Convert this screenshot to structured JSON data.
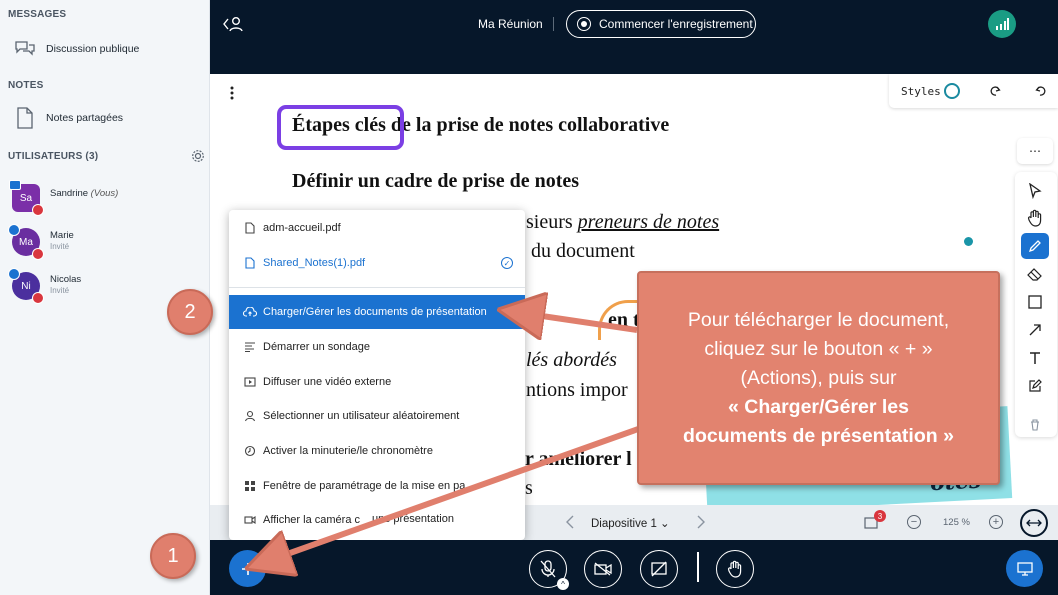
{
  "sidebar": {
    "messages_title": "MESSAGES",
    "public_chat": "Discussion publique",
    "notes_title": "NOTES",
    "shared_notes": "Notes partagées",
    "users_title": "UTILISATEURS (3)",
    "users": [
      {
        "initials": "Sa",
        "name": "Sandrine",
        "suffix": "(Vous)",
        "role": "",
        "color": "#7b2fa8"
      },
      {
        "initials": "Ma",
        "name": "Marie",
        "suffix": "",
        "role": "Invité",
        "color": "#6a2ea0"
      },
      {
        "initials": "Ni",
        "name": "Nicolas",
        "suffix": "",
        "role": "Invité",
        "color": "#4b2f9e"
      }
    ]
  },
  "topbar": {
    "meeting_title": "Ma Réunion",
    "record_label": "Commencer l'enregistrement"
  },
  "presentation": {
    "styles_label": "Styles",
    "slide_label": "Diapositive 1",
    "zoom": "125 %",
    "notification_count": "3",
    "lines": [
      {
        "b": "Étapes clés",
        "text": " de la prise de notes collaborative"
      },
      {
        "text": "Définir un cadre de prise de notes"
      },
      {
        "pre": "sieurs ",
        "u": "preneurs de notes"
      },
      {
        "text": "du document"
      },
      {
        "text": "en t"
      },
      {
        "text": "lés abordés"
      },
      {
        "text": "ntions impor"
      },
      {
        "text": "r améliorer l"
      },
      {
        "text": "s"
      }
    ],
    "sticker_text": "otes"
  },
  "menu": {
    "files": [
      "adm-accueil.pdf",
      "Shared_Notes(1).pdf"
    ],
    "items": [
      "Charger/Gérer les documents de présentation",
      "Démarrer un sondage",
      "Diffuser une vidéo externe",
      "Sélectionner un utilisateur aléatoirement",
      "Activer la minuterie/le chronomètre",
      "Fenêtre de paramétrage de la mise en pa",
      "Afficher la caméra c",
      "une présentation"
    ]
  },
  "callout": {
    "badge_1": "1",
    "badge_2": "2",
    "line1": "Pour télécharger le document,",
    "line2": "cliquez sur le bouton « + »",
    "line3": "(Actions), puis sur",
    "line4": "« Charger/Gérer les",
    "line5": "documents de présentation »"
  },
  "colors": {
    "accent": "#1b72d0",
    "callout": "#e2836f",
    "dark": "#06172a",
    "frame_purple": "#7b3fe4"
  }
}
